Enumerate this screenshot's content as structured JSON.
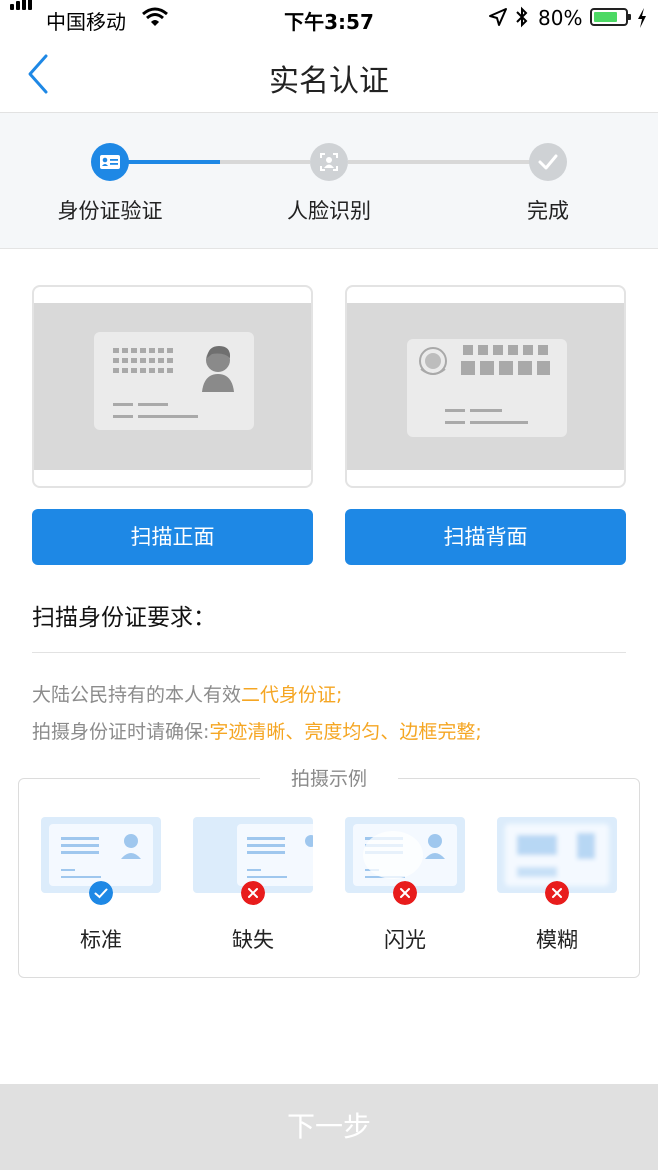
{
  "status_bar": {
    "carrier": "中国移动",
    "time": "下午3:57",
    "battery_percent": "80%",
    "battery_level": 0.8,
    "icons": [
      "signal-icon",
      "wifi-icon",
      "location-arrow-icon",
      "bluetooth-icon",
      "battery-icon",
      "charging-icon"
    ]
  },
  "nav": {
    "title": "实名认证",
    "back_icon": "chevron-left-icon"
  },
  "steps": [
    {
      "label": "身份证验证",
      "icon": "id-card-icon",
      "state": "active"
    },
    {
      "label": "人脸识别",
      "icon": "face-scan-icon",
      "state": "pending"
    },
    {
      "label": "完成",
      "icon": "check-icon",
      "state": "pending"
    }
  ],
  "id_cards": {
    "front": {
      "icon": "id-card-front-icon",
      "button": "扫描正面"
    },
    "back": {
      "icon": "id-card-back-icon",
      "button": "扫描背面"
    }
  },
  "requirements": {
    "title": "扫描身份证要求：",
    "line1_text": "大陆公民持有的本人有效",
    "line1_highlight": "二代身份证;",
    "line2_text": "拍摄身份证时请确保:",
    "line2_highlight": "字迹清晰、亮度均匀、边框完整;"
  },
  "examples": {
    "title": "拍摄示例",
    "items": [
      {
        "label": "标准",
        "status": "ok",
        "icon": "check-circle-icon"
      },
      {
        "label": "缺失",
        "status": "error",
        "icon": "x-circle-icon"
      },
      {
        "label": "闪光",
        "status": "error",
        "icon": "x-circle-icon"
      },
      {
        "label": "模糊",
        "status": "error",
        "icon": "x-circle-icon"
      }
    ]
  },
  "next_button": "下一步",
  "colors": {
    "accent": "#1e88e5",
    "highlight": "#f5a623",
    "error": "#e81c1c",
    "disabled_button": "#e0e0e0"
  }
}
